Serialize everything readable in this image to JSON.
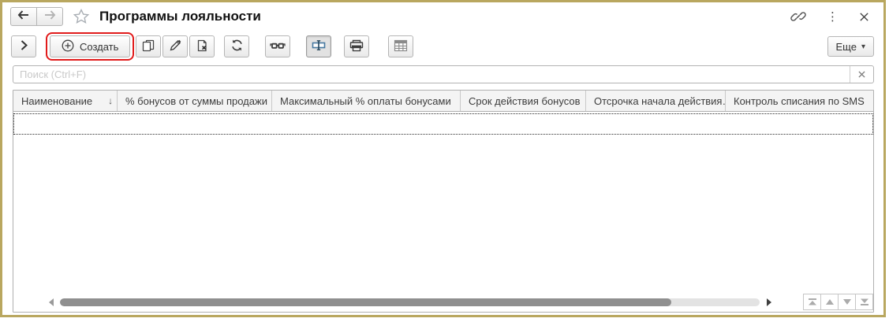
{
  "header": {
    "title": "Программы лояльности"
  },
  "toolbar": {
    "create_label": "Создать",
    "more_label": "Еще"
  },
  "search": {
    "placeholder": "Поиск (Ctrl+F)"
  },
  "table": {
    "columns": [
      "Наименование",
      "% бонусов от суммы продажи",
      "Максимальный % оплаты бонусами",
      "Срок действия бонусов",
      "Отсрочка начала действия…",
      "Контроль списания по SMS"
    ],
    "sort_indicator": "↓",
    "rows": []
  },
  "icons": {
    "kebab": "⋮",
    "more_caret": "▾"
  },
  "colors": {
    "window_border": "#b9a75f",
    "annotation_red": "#e11b1b",
    "pressed_icon_blue": "#4678a0",
    "scrollbar_thumb": "#8f8f8f",
    "header_bg": "#f4f4f4"
  }
}
